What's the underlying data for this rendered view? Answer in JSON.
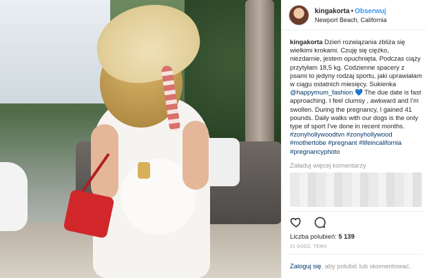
{
  "post": {
    "image_alt": "photo",
    "username": "kingakorta",
    "follow_label": "Obserwuj",
    "location": "Newport Beach, California",
    "caption": {
      "user": "kingakorta",
      "text_pl": "Dzień rozwiązania zbliża się wielkimi krokami. Czuję się ciężko, niezdarnie, jestem opuchnięta. Podczas ciąży przytyłam 18,5 kg. Codzienne spacery z psami to jedyny rodzaj sportu, jaki uprawiałam w ciągu ostatnich miesięcy. Sukienka",
      "mention": "@happymum_fashion",
      "text_en": "The due date is fast approaching. I feel clumsy , awkward and I'm swollen. During the pregnancy, I gained 41 pounds. Daily walks with our dogs is the only type of sport I've done in recent months.",
      "tags": [
        "#zonyhollywoodtvn",
        "#zonyhollywood",
        "#mothertobe",
        "#pregnant",
        "#lifeincalifornia",
        "#pregnancyphoto"
      ]
    },
    "load_more": "Załaduj więcej komentarzy",
    "likes_label": "Liczba polubień:",
    "likes_count": "5 139",
    "time_ago": "21 GODZ. TEMU",
    "login": {
      "link": "Zaloguj się",
      "text": ", aby polubić lub skomentować."
    }
  },
  "colors": {
    "follow_blue": "#3897f0",
    "link_dark_blue": "#003569",
    "muted_gray": "#999999",
    "text": "#262626"
  },
  "icons": [
    "heart-icon",
    "comment-icon",
    "blue-heart-emoji"
  ]
}
